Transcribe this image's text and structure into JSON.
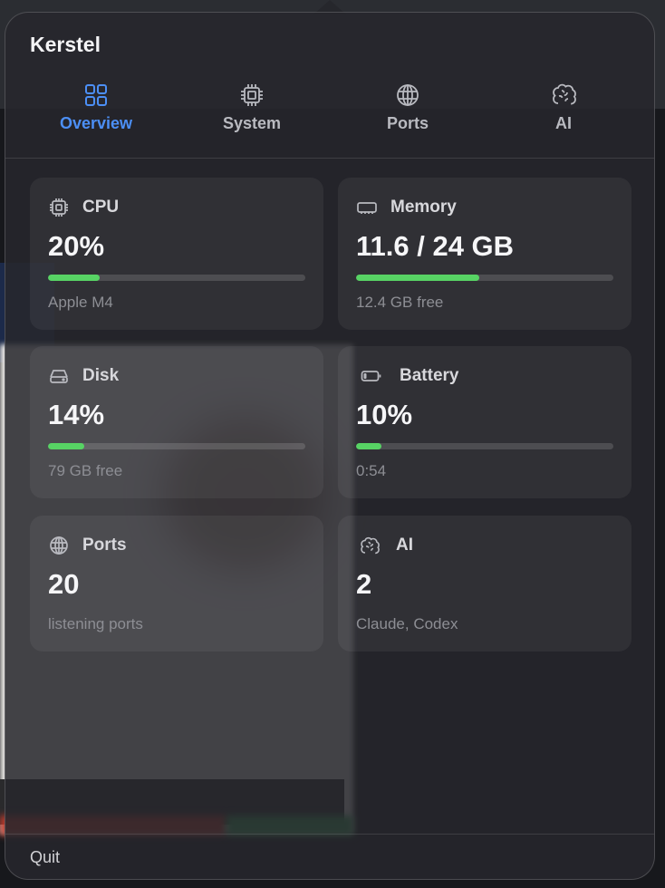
{
  "app": {
    "title": "Kerstel"
  },
  "tabs": [
    {
      "label": "Overview",
      "icon": "grid-icon",
      "active": true
    },
    {
      "label": "System",
      "icon": "chip-icon",
      "active": false
    },
    {
      "label": "Ports",
      "icon": "globe-icon",
      "active": false
    },
    {
      "label": "AI",
      "icon": "brain-icon",
      "active": false
    }
  ],
  "cards": {
    "cpu": {
      "title": "CPU",
      "value": "20%",
      "usage": 0.2,
      "detail": "Apple M4",
      "icon": "cpu-icon"
    },
    "memory": {
      "title": "Memory",
      "value": "11.6 / 24 GB",
      "usage": 0.48,
      "detail": "12.4 GB free",
      "icon": "memory-icon"
    },
    "disk": {
      "title": "Disk",
      "value": "14%",
      "usage": 0.14,
      "detail": "79 GB free",
      "icon": "disk-icon"
    },
    "battery": {
      "title": "Battery",
      "value": "10%",
      "usage": 0.1,
      "detail": "0:54",
      "icon": "battery-icon"
    },
    "ports": {
      "title": "Ports",
      "value": "20",
      "detail": "listening ports",
      "icon": "globe-icon"
    },
    "ai": {
      "title": "AI",
      "value": "2",
      "detail": "Claude, Codex",
      "icon": "brain-icon"
    }
  },
  "footer": {
    "quit_label": "Quit"
  },
  "colors": {
    "accent": "#4c8ff5",
    "bar_fill": "#57d364"
  }
}
